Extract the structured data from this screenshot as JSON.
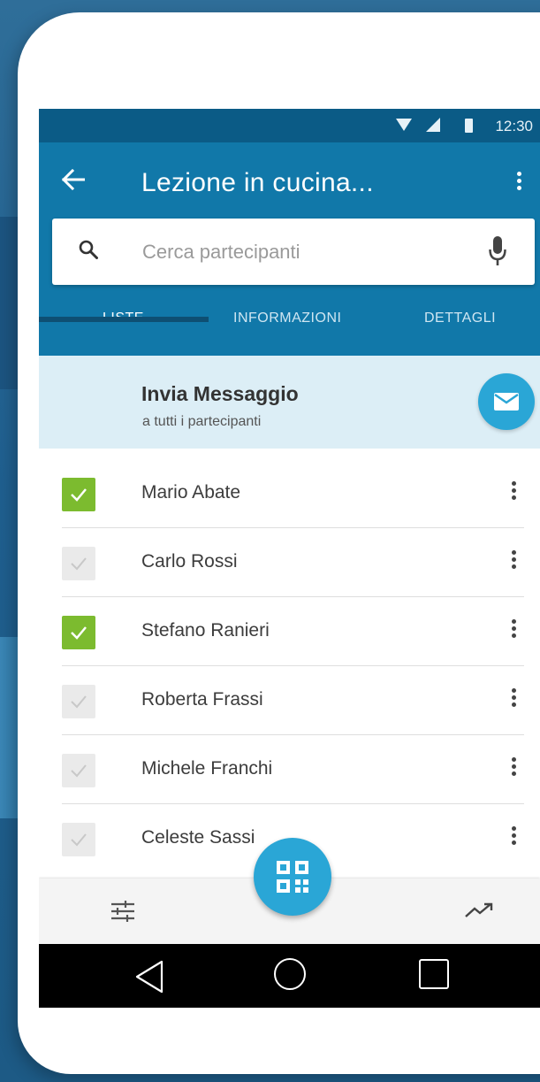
{
  "status": {
    "time": "12:30"
  },
  "appbar": {
    "title": "Lezione in cucina...",
    "search_placeholder": "Cerca partecipanti",
    "tabs": [
      {
        "label": "LISTE",
        "active": true
      },
      {
        "label": "INFORMAZIONI",
        "active": false
      },
      {
        "label": "DETTAGLI",
        "active": false
      }
    ]
  },
  "banner": {
    "title": "Invia Messaggio",
    "subtitle": "a tutti i partecipanti"
  },
  "participants": [
    {
      "name": "Mario Abate",
      "checked": true
    },
    {
      "name": "Carlo Rossi",
      "checked": false
    },
    {
      "name": "Stefano Ranieri",
      "checked": true
    },
    {
      "name": "Roberta Frassi",
      "checked": false
    },
    {
      "name": "Michele Franchi",
      "checked": false
    },
    {
      "name": "Celeste Sassi",
      "checked": false
    }
  ],
  "icons": {
    "back": "arrow-back-icon",
    "search": "search-icon",
    "mic": "mic-icon",
    "mail": "mail-icon",
    "fab": "qr-code-icon",
    "left_bottom": "tune-icon",
    "right_bottom": "trending-up-icon"
  },
  "colors": {
    "primary": "#1178a9",
    "status_bar": "#0b5b86",
    "accent": "#2aa6d6",
    "check_on": "#7cbb2f",
    "banner_bg": "#dceef6"
  }
}
